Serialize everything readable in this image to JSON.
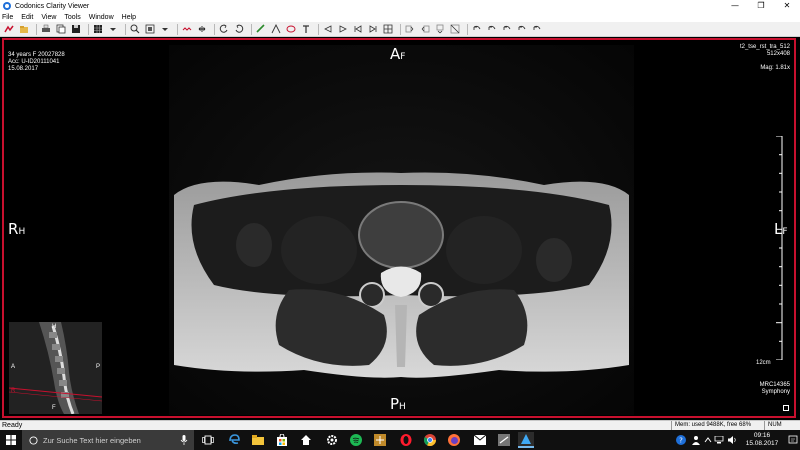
{
  "window": {
    "title": "Codonics Clarity Viewer",
    "minimize": "—",
    "maximize": "❐",
    "close": "✕"
  },
  "menu": [
    "File",
    "Edit",
    "View",
    "Tools",
    "Window",
    "Help"
  ],
  "overlay": {
    "top_left": [
      "34 years F 20027828",
      "Acc: U-ID20111041",
      "15.08.2017"
    ],
    "top_right": [
      "t2_tse_rst_tra_512",
      "512x408",
      "",
      "Mag: 1.81x"
    ],
    "bottom_right": [
      "MRC14365",
      "Symphony"
    ],
    "scale_label": "12cm"
  },
  "orientation": {
    "top": {
      "big": "A",
      "small": "F"
    },
    "bottom": {
      "big": "P",
      "small": "H"
    },
    "left": {
      "big": "R",
      "small": "H"
    },
    "right": {
      "big": "L",
      "small": "F"
    }
  },
  "scout": {
    "top": "H",
    "left": "A",
    "right": "P",
    "bottom": "F",
    "bottom_left": "R"
  },
  "status": {
    "ready": "Ready",
    "memory": "Mem: used 9488K, free 68%",
    "num": "NUM"
  },
  "taskbar": {
    "search_placeholder": "Zur Suche Text hier eingeben",
    "time": "09:16",
    "date": "15.08.2017"
  }
}
